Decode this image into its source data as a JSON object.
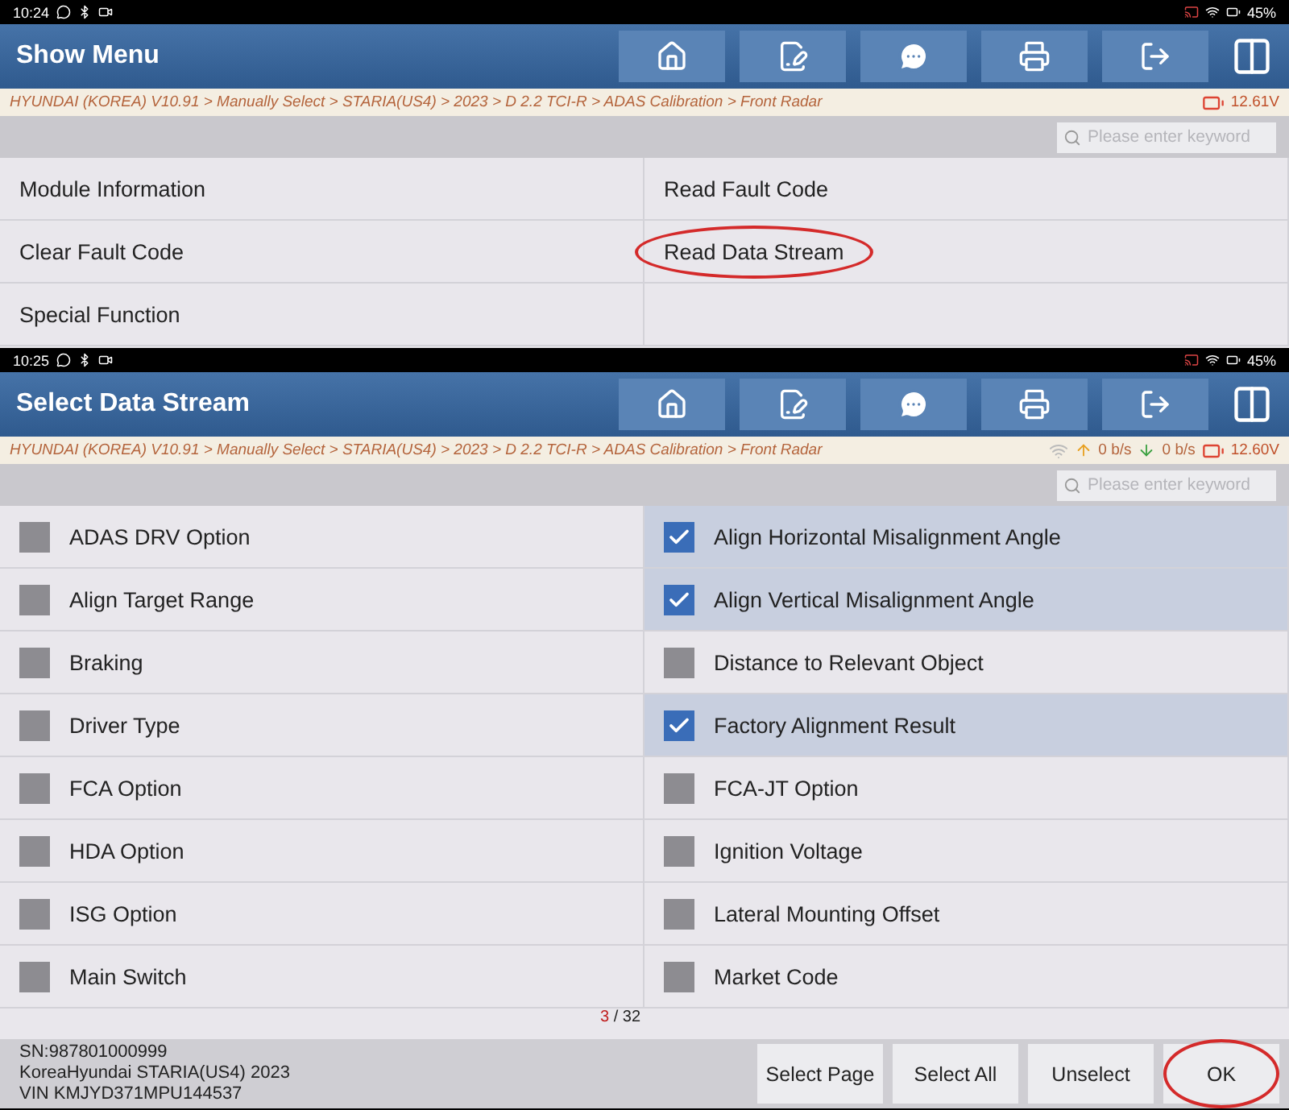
{
  "screens": [
    {
      "kind": "menu",
      "status_bar": {
        "time": "10:24",
        "battery": "45%"
      },
      "title": "Show Menu",
      "breadcrumb": "HYUNDAI (KOREA) V10.91 > Manually Select > STARIA(US4) > 2023 > D 2.2 TCI-R > ADAS Calibration > Front Radar",
      "voltage": "12.61V",
      "search": {
        "placeholder": "Please enter keyword"
      },
      "items": [
        {
          "label": "Module Information",
          "circled": false
        },
        {
          "label": "Read Fault Code",
          "circled": false
        },
        {
          "label": "Clear Fault Code",
          "circled": false
        },
        {
          "label": "Read Data Stream",
          "circled": true
        },
        {
          "label": "Special Function",
          "circled": false
        }
      ]
    },
    {
      "kind": "datastream",
      "status_bar": {
        "time": "10:25",
        "battery": "45%"
      },
      "title": "Select Data Stream",
      "breadcrumb": "HYUNDAI (KOREA) V10.91 > Manually Select > STARIA(US4) > 2023 > D 2.2 TCI-R > ADAS Calibration > Front Radar",
      "traffic": {
        "up": "0 b/s",
        "down": "0 b/s"
      },
      "voltage": "12.60V",
      "search": {
        "placeholder": "Please enter keyword"
      },
      "items": [
        {
          "label": "ADAS DRV Option",
          "checked": false
        },
        {
          "label": "Align Horizontal Misalignment Angle",
          "checked": true
        },
        {
          "label": "Align Target Range",
          "checked": false
        },
        {
          "label": "Align Vertical Misalignment Angle",
          "checked": true
        },
        {
          "label": "Braking",
          "checked": false
        },
        {
          "label": "Distance to Relevant Object",
          "checked": false
        },
        {
          "label": "Driver Type",
          "checked": false
        },
        {
          "label": "Factory Alignment Result",
          "checked": true
        },
        {
          "label": "FCA Option",
          "checked": false
        },
        {
          "label": "FCA-JT Option",
          "checked": false
        },
        {
          "label": "HDA Option",
          "checked": false
        },
        {
          "label": "Ignition Voltage",
          "checked": false
        },
        {
          "label": "ISG Option",
          "checked": false
        },
        {
          "label": "Lateral Mounting Offset",
          "checked": false
        },
        {
          "label": "Main Switch",
          "checked": false
        },
        {
          "label": "Market Code",
          "checked": false
        }
      ],
      "page": {
        "current": "3",
        "separator": "/",
        "total": "32"
      },
      "vehicle_info": [
        "SN:987801000999",
        "KoreaHyundai STARIA(US4) 2023",
        "VIN KMJYD371MPU144537"
      ],
      "buttons": [
        {
          "label": "Select Page",
          "circled": false
        },
        {
          "label": "Select All",
          "circled": false
        },
        {
          "label": "Unselect",
          "circled": false
        },
        {
          "label": "OK",
          "circled": true
        }
      ]
    }
  ]
}
